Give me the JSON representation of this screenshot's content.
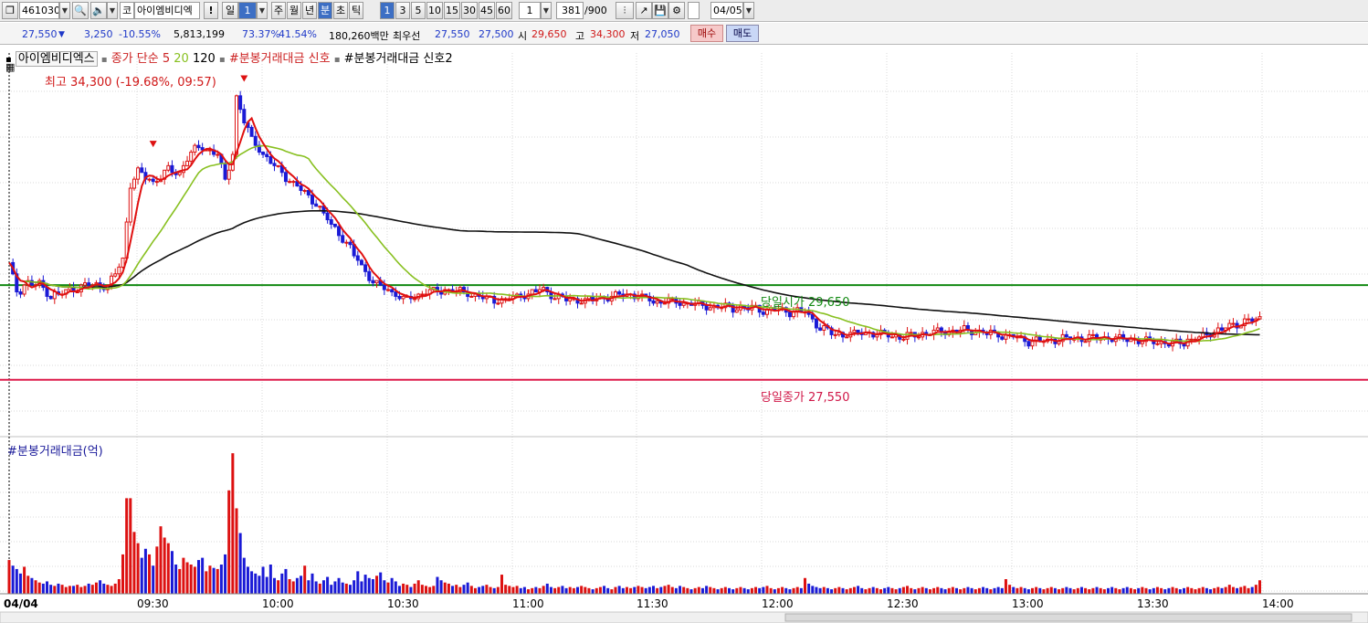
{
  "toolbar": {
    "code": "461030",
    "market": "코",
    "stock_name": "아이엠비디엑",
    "alert": "!",
    "period_day": "일",
    "period_num": "1",
    "periods": [
      "주",
      "월",
      "년",
      "분",
      "초",
      "틱"
    ],
    "interval_values": [
      "1",
      "3",
      "5",
      "10",
      "15",
      "30",
      "45",
      "60"
    ],
    "interval_input": "1",
    "count": "381",
    "count_total": "/900",
    "date": "04/05"
  },
  "quote": {
    "price": "27,550",
    "change": "3,250",
    "change_pct": "-10.55%",
    "volume": "5,813,199",
    "ratio1": "73.37%",
    "ratio2": "41.54%",
    "amount": "180,260백만",
    "best_label": "최우선",
    "ask": "27,550",
    "bid": "27,500",
    "open_label": "시",
    "open": "29,650",
    "high_label": "고",
    "high": "34,300",
    "low_label": "저",
    "low": "27,050",
    "buy_button": "매수",
    "sell_button": "매도"
  },
  "legend": {
    "name": "아이엠비디엑스",
    "ma_label": "종가 단순 5",
    "ma2": "20",
    "ma3": "120",
    "signal1": "#분봉거래대금 신호",
    "signal2": "#분봉거래대금 신호2"
  },
  "colors": {
    "up": "#dd1111",
    "down": "#1a1ad6",
    "ma5": "#e01010",
    "ma20": "#88c020",
    "ma120": "#111111",
    "open_line": "#138a13",
    "close_line": "#dd1a4a"
  },
  "chart_data": {
    "type": "candlestick",
    "x_labels": [
      "04/04",
      "09:30",
      "10:00",
      "10:30",
      "11:00",
      "11:30",
      "12:00",
      "12:30",
      "13:00",
      "13:30",
      "14:00"
    ],
    "annotations": {
      "high": "최고 34,300 (-19.68%, 09:57)",
      "open": "당일시가 29,650",
      "close": "당일종가 27,550"
    },
    "open_value": 29650,
    "close_value": 27550,
    "high_value": 34300,
    "low_value": 27050,
    "volume_title": "#분봉거래대금(억)",
    "price_ylim": [
      26450,
      34800
    ],
    "price_path": [
      [
        0,
        30100
      ],
      [
        2,
        29500
      ],
      [
        5,
        29700
      ],
      [
        8,
        29650
      ],
      [
        11,
        29400
      ],
      [
        13,
        29450
      ],
      [
        20,
        29650
      ],
      [
        26,
        29620
      ],
      [
        30,
        30200
      ],
      [
        32,
        31900
      ],
      [
        34,
        32150
      ],
      [
        38,
        31950
      ],
      [
        42,
        32200
      ],
      [
        45,
        32150
      ],
      [
        48,
        32600
      ],
      [
        51,
        32700
      ],
      [
        55,
        32550
      ],
      [
        57,
        31950
      ],
      [
        59,
        32600
      ],
      [
        60,
        33800
      ],
      [
        62,
        33300
      ],
      [
        64,
        32900
      ],
      [
        67,
        32550
      ],
      [
        70,
        32300
      ],
      [
        73,
        32050
      ],
      [
        76,
        31850
      ],
      [
        80,
        31550
      ],
      [
        84,
        31100
      ],
      [
        88,
        30700
      ],
      [
        92,
        30200
      ],
      [
        96,
        29700
      ],
      [
        102,
        29450
      ],
      [
        104,
        29300
      ],
      [
        110,
        29500
      ],
      [
        116,
        29550
      ],
      [
        122,
        29450
      ],
      [
        128,
        29300
      ],
      [
        134,
        29400
      ],
      [
        140,
        29550
      ],
      [
        146,
        29350
      ],
      [
        152,
        29300
      ],
      [
        158,
        29400
      ],
      [
        164,
        29450
      ],
      [
        170,
        29300
      ],
      [
        178,
        29250
      ],
      [
        186,
        29150
      ],
      [
        194,
        29150
      ],
      [
        200,
        29100
      ],
      [
        210,
        29050
      ],
      [
        214,
        28700
      ],
      [
        218,
        28550
      ],
      [
        226,
        28600
      ],
      [
        236,
        28500
      ],
      [
        244,
        28600
      ],
      [
        252,
        28650
      ],
      [
        262,
        28550
      ],
      [
        270,
        28400
      ],
      [
        278,
        28450
      ],
      [
        290,
        28500
      ],
      [
        300,
        28400
      ],
      [
        308,
        28350
      ],
      [
        316,
        28550
      ],
      [
        324,
        28800
      ],
      [
        330,
        28900
      ]
    ],
    "volume_values": [
      3,
      2.5,
      2.2,
      1.8,
      2.4,
      1.6,
      1.4,
      1.2,
      1,
      0.9,
      1.1,
      0.8,
      0.7,
      0.9,
      0.8,
      0.6,
      0.7,
      0.7,
      0.8,
      0.6,
      0.7,
      0.9,
      0.8,
      1,
      1.2,
      0.9,
      0.8,
      0.7,
      0.9,
      1.3,
      3.5,
      8.5,
      8.5,
      5.5,
      4.5,
      3.2,
      4,
      3.5,
      2.5,
      4.2,
      6,
      5,
      4.5,
      3.8,
      2.6,
      2.2,
      3.2,
      2.8,
      2.6,
      2.4,
      3,
      3.2,
      2,
      2.5,
      2.3,
      2.2,
      2.6,
      3.5,
      9.2,
      12.5,
      7.6,
      5.4,
      3.2,
      2.4,
      2,
      1.8,
      1.6,
      2.4,
      1.5,
      2.6,
      1.4,
      1.2,
      1.8,
      2.2,
      1.3,
      1.1,
      1.4,
      1.6,
      2.5,
      1.2,
      1.8,
      1.1,
      0.9,
      1.2,
      1.5,
      0.8,
      1.1,
      1.4,
      1,
      0.9,
      0.8,
      1.2,
      2,
      1.1,
      1.7,
      1.4,
      1.3,
      1.6,
      1.9,
      1.2,
      1,
      1.4,
      1.1,
      0.7,
      0.9,
      0.8,
      0.6,
      0.9,
      1.2,
      0.8,
      0.7,
      0.6,
      0.7,
      1.5,
      1.2,
      1,
      0.9,
      0.7,
      0.8,
      0.6,
      0.8,
      1,
      0.7,
      0.5,
      0.6,
      0.7,
      0.8,
      0.6,
      0.5,
      0.6,
      1.7,
      0.8,
      0.7,
      0.6,
      0.7,
      0.5,
      0.6,
      0.4,
      0.5,
      0.6,
      0.5,
      0.7,
      0.9,
      0.6,
      0.5,
      0.6,
      0.7,
      0.5,
      0.6,
      0.5,
      0.6,
      0.7,
      0.6,
      0.5,
      0.4,
      0.5,
      0.6,
      0.7,
      0.5,
      0.4,
      0.6,
      0.7,
      0.5,
      0.6,
      0.5,
      0.6,
      0.7,
      0.6,
      0.5,
      0.6,
      0.7,
      0.5,
      0.6,
      0.7,
      0.8,
      0.6,
      0.5,
      0.7,
      0.6,
      0.5,
      0.4,
      0.5,
      0.6,
      0.5,
      0.7,
      0.6,
      0.5,
      0.4,
      0.5,
      0.6,
      0.5,
      0.4,
      0.5,
      0.6,
      0.5,
      0.4,
      0.5,
      0.6,
      0.5,
      0.6,
      0.7,
      0.5,
      0.4,
      0.5,
      0.6,
      0.5,
      0.4,
      0.5,
      0.6,
      0.5,
      1.4,
      0.9,
      0.7,
      0.6,
      0.5,
      0.6,
      0.5,
      0.4,
      0.5,
      0.6,
      0.5,
      0.4,
      0.5,
      0.6,
      0.7,
      0.5,
      0.4,
      0.5,
      0.6,
      0.5,
      0.4,
      0.5,
      0.6,
      0.5,
      0.4,
      0.5,
      0.6,
      0.7,
      0.5,
      0.4,
      0.5,
      0.6,
      0.5,
      0.4,
      0.5,
      0.6,
      0.5,
      0.4,
      0.5,
      0.6,
      0.5,
      0.4,
      0.5,
      0.6,
      0.5,
      0.4,
      0.5,
      0.6,
      0.5,
      0.4,
      0.5,
      0.6,
      0.5,
      1.3,
      0.8,
      0.6,
      0.5,
      0.6,
      0.5,
      0.4,
      0.5,
      0.6,
      0.5,
      0.4,
      0.5,
      0.6,
      0.5,
      0.4,
      0.5,
      0.6,
      0.5,
      0.4,
      0.5,
      0.6,
      0.5,
      0.4,
      0.5,
      0.6,
      0.5,
      0.4,
      0.5,
      0.6,
      0.5,
      0.4,
      0.5,
      0.6,
      0.5,
      0.4,
      0.5,
      0.6,
      0.5,
      0.4,
      0.5,
      0.6,
      0.5,
      0.4,
      0.5,
      0.6,
      0.5,
      0.4,
      0.5,
      0.6,
      0.5,
      0.4,
      0.5,
      0.6,
      0.5,
      0.4,
      0.5,
      0.6,
      0.5,
      0.6,
      0.8,
      0.6,
      0.5,
      0.6,
      0.7,
      0.5,
      0.6,
      0.8,
      1.2
    ]
  }
}
